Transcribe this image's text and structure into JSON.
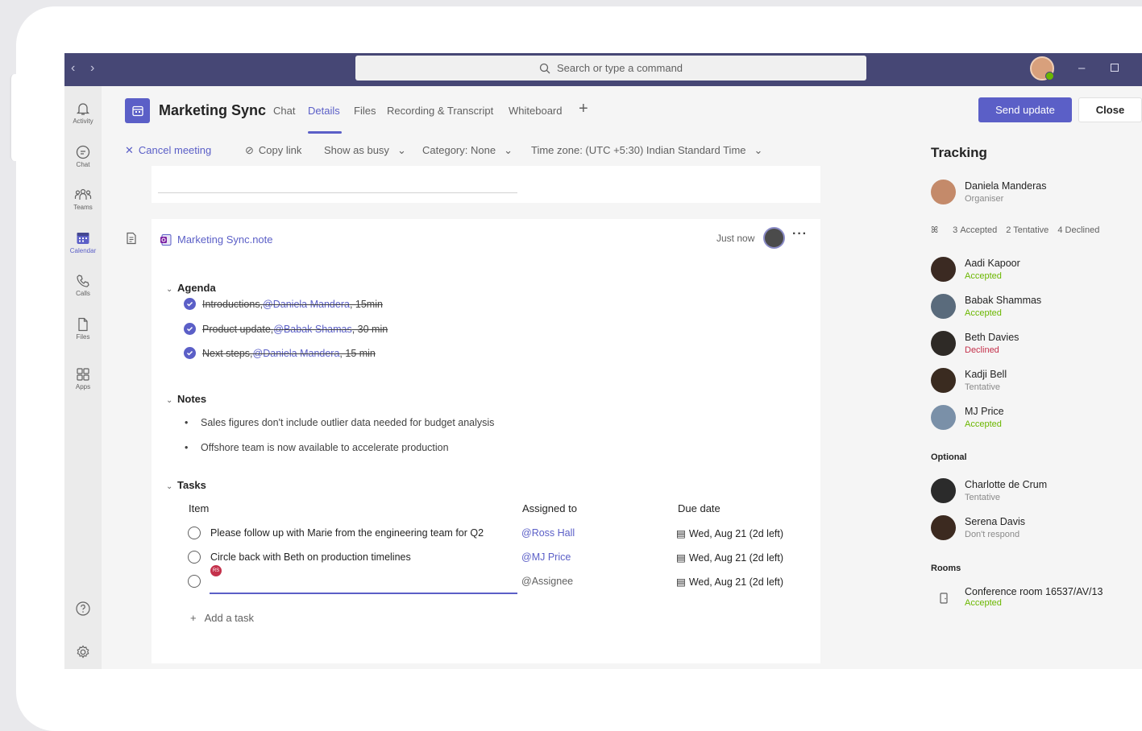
{
  "titlebar": {
    "back_glyph": "‹",
    "forward_glyph": "›",
    "search_placeholder": "Search or type a command",
    "minimize_glyph": "–"
  },
  "rail": {
    "items": [
      {
        "label": "Activity",
        "icon": "bell-icon"
      },
      {
        "label": "Chat",
        "icon": "chat-icon"
      },
      {
        "label": "Teams",
        "icon": "teams-icon"
      },
      {
        "label": "Calendar",
        "icon": "calendar-icon"
      },
      {
        "label": "Calls",
        "icon": "phone-icon"
      },
      {
        "label": "Files",
        "icon": "file-icon"
      },
      {
        "label": "Apps",
        "icon": "apps-icon"
      }
    ]
  },
  "header": {
    "title": "Marketing Sync",
    "tabs": [
      "Chat",
      "Details",
      "Files",
      "Recording & Transcript",
      "Whiteboard"
    ],
    "active_tab": "Details",
    "send_update": "Send update",
    "close": "Close"
  },
  "toolbar": {
    "cancel": "Cancel meeting",
    "copy_link": "Copy link",
    "show_as": "Show as busy",
    "category": "Category: None",
    "timezone": "Time zone: (UTC +5:30) Indian Standard Time"
  },
  "loop": {
    "name": "Marketing Sync.note",
    "time": "Just now",
    "more": "···",
    "agenda_title": "Agenda",
    "agenda": [
      {
        "text": "Introductions, ",
        "mention": "@Daniela Mandera",
        "rest": ", 15min"
      },
      {
        "text": "Product update, ",
        "mention": "@Babak Shamas",
        "rest": ", 30 min"
      },
      {
        "text": "Next steps, ",
        "mention": "@Daniela Mandera",
        "rest": ", 15 min"
      }
    ],
    "notes_title": "Notes",
    "notes": [
      "Sales figures don't include outlier data needed for budget analysis",
      "Offshore team is now available to accelerate production"
    ],
    "tasks_title": "Tasks",
    "task_headers": {
      "item": "Item",
      "assigned": "Assigned to",
      "due": "Due date"
    },
    "tasks": [
      {
        "item": "Please follow up with Marie from the engineering team for Q2",
        "assigned": "@Ross Hall",
        "due": "Wed, Aug 21 (2d left)"
      },
      {
        "item": "Circle back with Beth on production timelines",
        "assigned": "@MJ Price",
        "due": "Wed, Aug 21 (2d left)"
      },
      {
        "item": "",
        "assigned": "@Assignee",
        "due": "Wed, Aug 21 (2d left)",
        "editing_badge": "RS"
      }
    ],
    "add_task": "Add a task"
  },
  "tracking": {
    "title": "Tracking",
    "organizer": {
      "name": "Daniela Manderas",
      "status": "Organiser"
    },
    "summary": {
      "accepted": "3 Accepted",
      "tentative": "2 Tentative",
      "declined": "4 Declined"
    },
    "required": [
      {
        "name": "Aadi Kapoor",
        "status": "Accepted",
        "color": "#3b2a22"
      },
      {
        "name": "Babak Shammas",
        "status": "Accepted",
        "color": "#5a6b7c"
      },
      {
        "name": "Beth Davies",
        "status": "Declined",
        "color": "#2e2a26"
      },
      {
        "name": "Kadji Bell",
        "status": "Tentative",
        "color": "#3a2b20"
      },
      {
        "name": "MJ Price",
        "status": "Accepted",
        "color": "#7a90a8"
      }
    ],
    "optional_label": "Optional",
    "optional": [
      {
        "name": "Charlotte de Crum",
        "status": "Tentative",
        "color": "#2b2b2b"
      },
      {
        "name": "Serena Davis",
        "status": "Don't respond",
        "color": "#3c2a20"
      }
    ],
    "rooms_label": "Rooms",
    "room": {
      "name": "Conference room 16537/AV/13",
      "status": "Accepted"
    }
  }
}
